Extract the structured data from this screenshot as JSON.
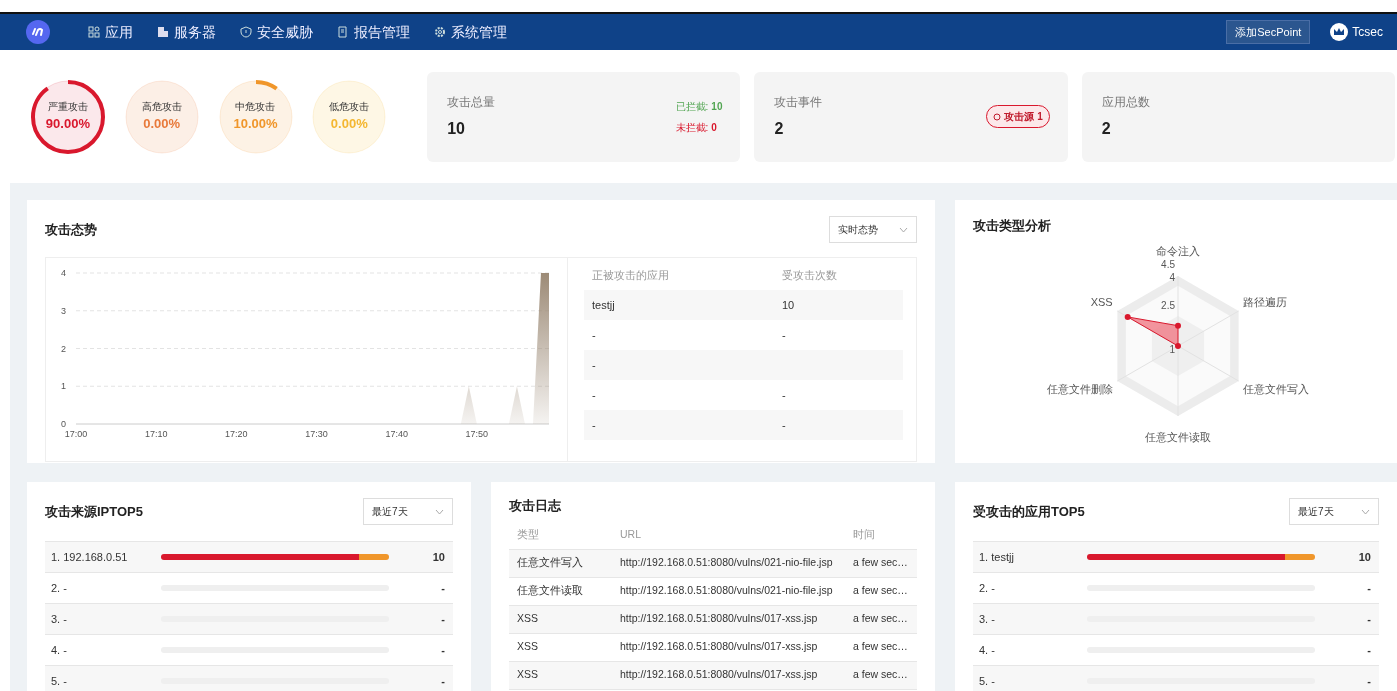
{
  "nav": {
    "items": [
      {
        "label": "应用"
      },
      {
        "label": "服务器"
      },
      {
        "label": "安全威胁"
      },
      {
        "label": "报告管理"
      },
      {
        "label": "系统管理"
      }
    ],
    "add_button": "添加SecPoint",
    "user": "Tcsec"
  },
  "severity": [
    {
      "label": "严重攻击",
      "value": "90.00%",
      "color": "#d9182d"
    },
    {
      "label": "高危攻击",
      "value": "0.00%",
      "color": "#e8793a"
    },
    {
      "label": "中危攻击",
      "value": "10.00%",
      "color": "#f0962a"
    },
    {
      "label": "低危攻击",
      "value": "0.00%",
      "color": "#f4b731"
    }
  ],
  "stats": [
    {
      "kind": "counts",
      "title": "攻击总量",
      "value": "10",
      "details": [
        {
          "label": "已拦截:",
          "count": "10",
          "color": "#52a552"
        },
        {
          "label": "未拦截:",
          "count": "0",
          "color": "#d9182d"
        }
      ]
    },
    {
      "kind": "badge",
      "title": "攻击事件",
      "value": "2",
      "badge": "攻击源 1"
    },
    {
      "kind": "plain",
      "title": "应用总数",
      "value": "2"
    }
  ],
  "trend": {
    "title": "攻击态势",
    "mode": "实时态势",
    "chart_data": {
      "type": "area",
      "categories": [
        "17:00",
        null,
        null,
        null,
        null,
        null,
        null,
        null,
        null,
        null,
        "17:10",
        null,
        null,
        null,
        null,
        null,
        null,
        null,
        null,
        null,
        "17:20",
        null,
        null,
        null,
        null,
        null,
        null,
        null,
        null,
        null,
        "17:30",
        null,
        null,
        null,
        null,
        null,
        null,
        null,
        null,
        null,
        "17:40",
        null,
        null,
        null,
        null,
        null,
        null,
        null,
        null,
        null,
        "17:50",
        null,
        null,
        null,
        null,
        null,
        null,
        null,
        null,
        null
      ],
      "series": [
        {
          "color": "#9c8a76",
          "values": [
            0,
            0,
            0,
            0,
            0,
            0,
            0,
            0,
            0,
            0,
            0,
            0,
            0,
            0,
            0,
            0,
            0,
            0,
            0,
            0,
            0,
            0,
            0,
            0,
            0,
            0,
            0,
            0,
            0,
            0,
            0,
            0,
            0,
            0,
            0,
            0,
            0,
            0,
            0,
            0,
            0,
            0,
            0,
            0,
            0,
            0,
            0,
            0,
            0,
            1,
            0,
            0,
            0,
            0,
            0,
            1,
            0,
            0,
            4,
            4
          ]
        }
      ],
      "ylim": [
        0,
        4
      ],
      "yticks": [
        0,
        1,
        2,
        3,
        4
      ],
      "grid": true
    },
    "table": {
      "columns": [
        "正被攻击的应用",
        "受攻击次数"
      ],
      "rows": [
        [
          "testjj",
          "10"
        ],
        [
          "-",
          "-"
        ],
        [
          "-"
        ],
        [
          "-",
          "-"
        ],
        [
          "-",
          "-"
        ]
      ]
    }
  },
  "types": {
    "title": "攻击类型分析",
    "axes": [
      "命令注入",
      "XSS",
      "路径遍历",
      "任意文件删除",
      "任意文件写入",
      "任意文件读取"
    ],
    "ticks": [
      "4.5",
      "4",
      "2.5",
      "1"
    ]
  },
  "source_ip": {
    "title": "攻击来源IPTOP5",
    "range": "最近7天",
    "rows": [
      {
        "label": "1. 192.168.0.51",
        "count": "10",
        "segments": [
          {
            "color": "#d9182d",
            "level": 0.87
          },
          {
            "color": "#f0962a",
            "level": 0.13
          }
        ]
      },
      {
        "label": "2. -",
        "count": "-"
      },
      {
        "label": "3. -",
        "count": "-"
      },
      {
        "label": "4. -",
        "count": "-"
      },
      {
        "label": "5. -",
        "count": "-"
      }
    ]
  },
  "log": {
    "title": "攻击日志",
    "columns": [
      "类型",
      "URL",
      "时间"
    ],
    "rows": [
      [
        "任意文件写入",
        "http://192.168.0.51:8080/vulns/021-nio-file.jsp",
        "a few sec…"
      ],
      [
        "任意文件读取",
        "http://192.168.0.51:8080/vulns/021-nio-file.jsp",
        "a few sec…"
      ],
      [
        "XSS",
        "http://192.168.0.51:8080/vulns/017-xss.jsp",
        "a few sec…"
      ],
      [
        "XSS",
        "http://192.168.0.51:8080/vulns/017-xss.jsp",
        "a few sec…"
      ],
      [
        "XSS",
        "http://192.168.0.51:8080/vulns/017-xss.jsp",
        "a few sec…"
      ]
    ]
  },
  "app_top": {
    "title": "受攻击的应用TOP5",
    "range": "最近7天",
    "rows": [
      {
        "label": "1. testjj",
        "count": "10",
        "segments": [
          {
            "color": "#d9182d",
            "level": 0.87
          },
          {
            "color": "#f0962a",
            "level": 0.13
          }
        ]
      },
      {
        "label": "2. -",
        "count": "-"
      },
      {
        "label": "3. -",
        "count": "-"
      },
      {
        "label": "4. -",
        "count": "-"
      },
      {
        "label": "5. -",
        "count": "-"
      }
    ]
  }
}
